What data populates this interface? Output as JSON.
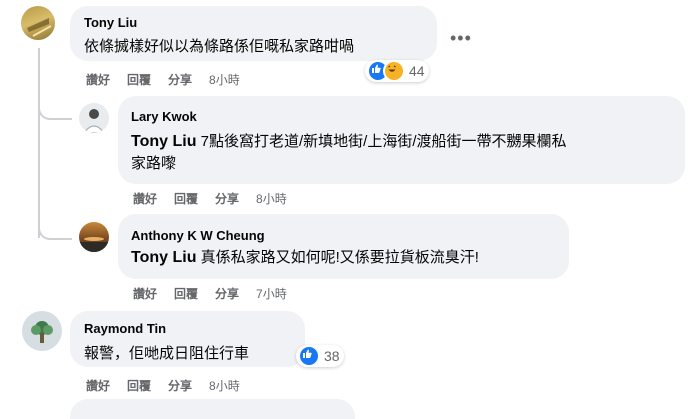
{
  "more_label": "•••",
  "comments": [
    {
      "author": "Tony Liu",
      "text": "依條搣樣好似以為條路係佢嘅私家路咁喎",
      "actions": {
        "like": "讚好",
        "reply": "回覆",
        "share": "分享"
      },
      "time": "8小時",
      "reaction_count": "44",
      "reaction_icons": [
        "like-icon",
        "haha-icon"
      ]
    },
    {
      "author": "Lary Kwok",
      "tag": "Tony Liu",
      "text_line1": "7點後窩打老道/新填地街/上海街/渡船街一帶不嬲果欄私",
      "text_line2": "家路嚟",
      "actions": {
        "like": "讚好",
        "reply": "回覆",
        "share": "分享"
      },
      "time": "8小時"
    },
    {
      "author": "Anthony K W Cheung",
      "tag": "Tony Liu",
      "text": "真係私家路又如何呢!又係要拉貨板流臭汗!",
      "actions": {
        "like": "讚好",
        "reply": "回覆",
        "share": "分享"
      },
      "time": "7小時"
    },
    {
      "author": "Raymond Tin",
      "text": "報警，佢哋成日阻住行車",
      "actions": {
        "like": "讚好",
        "reply": "回覆",
        "share": "分享"
      },
      "time": "8小時",
      "reaction_count": "38",
      "reaction_icons": [
        "like-icon"
      ]
    }
  ],
  "colors": {
    "bubble": "#f0f2f5",
    "meta_text": "#65676b",
    "thread_line": "#ced0d4",
    "like_blue": "#1877f2",
    "haha_yellow": "#f7b125"
  }
}
